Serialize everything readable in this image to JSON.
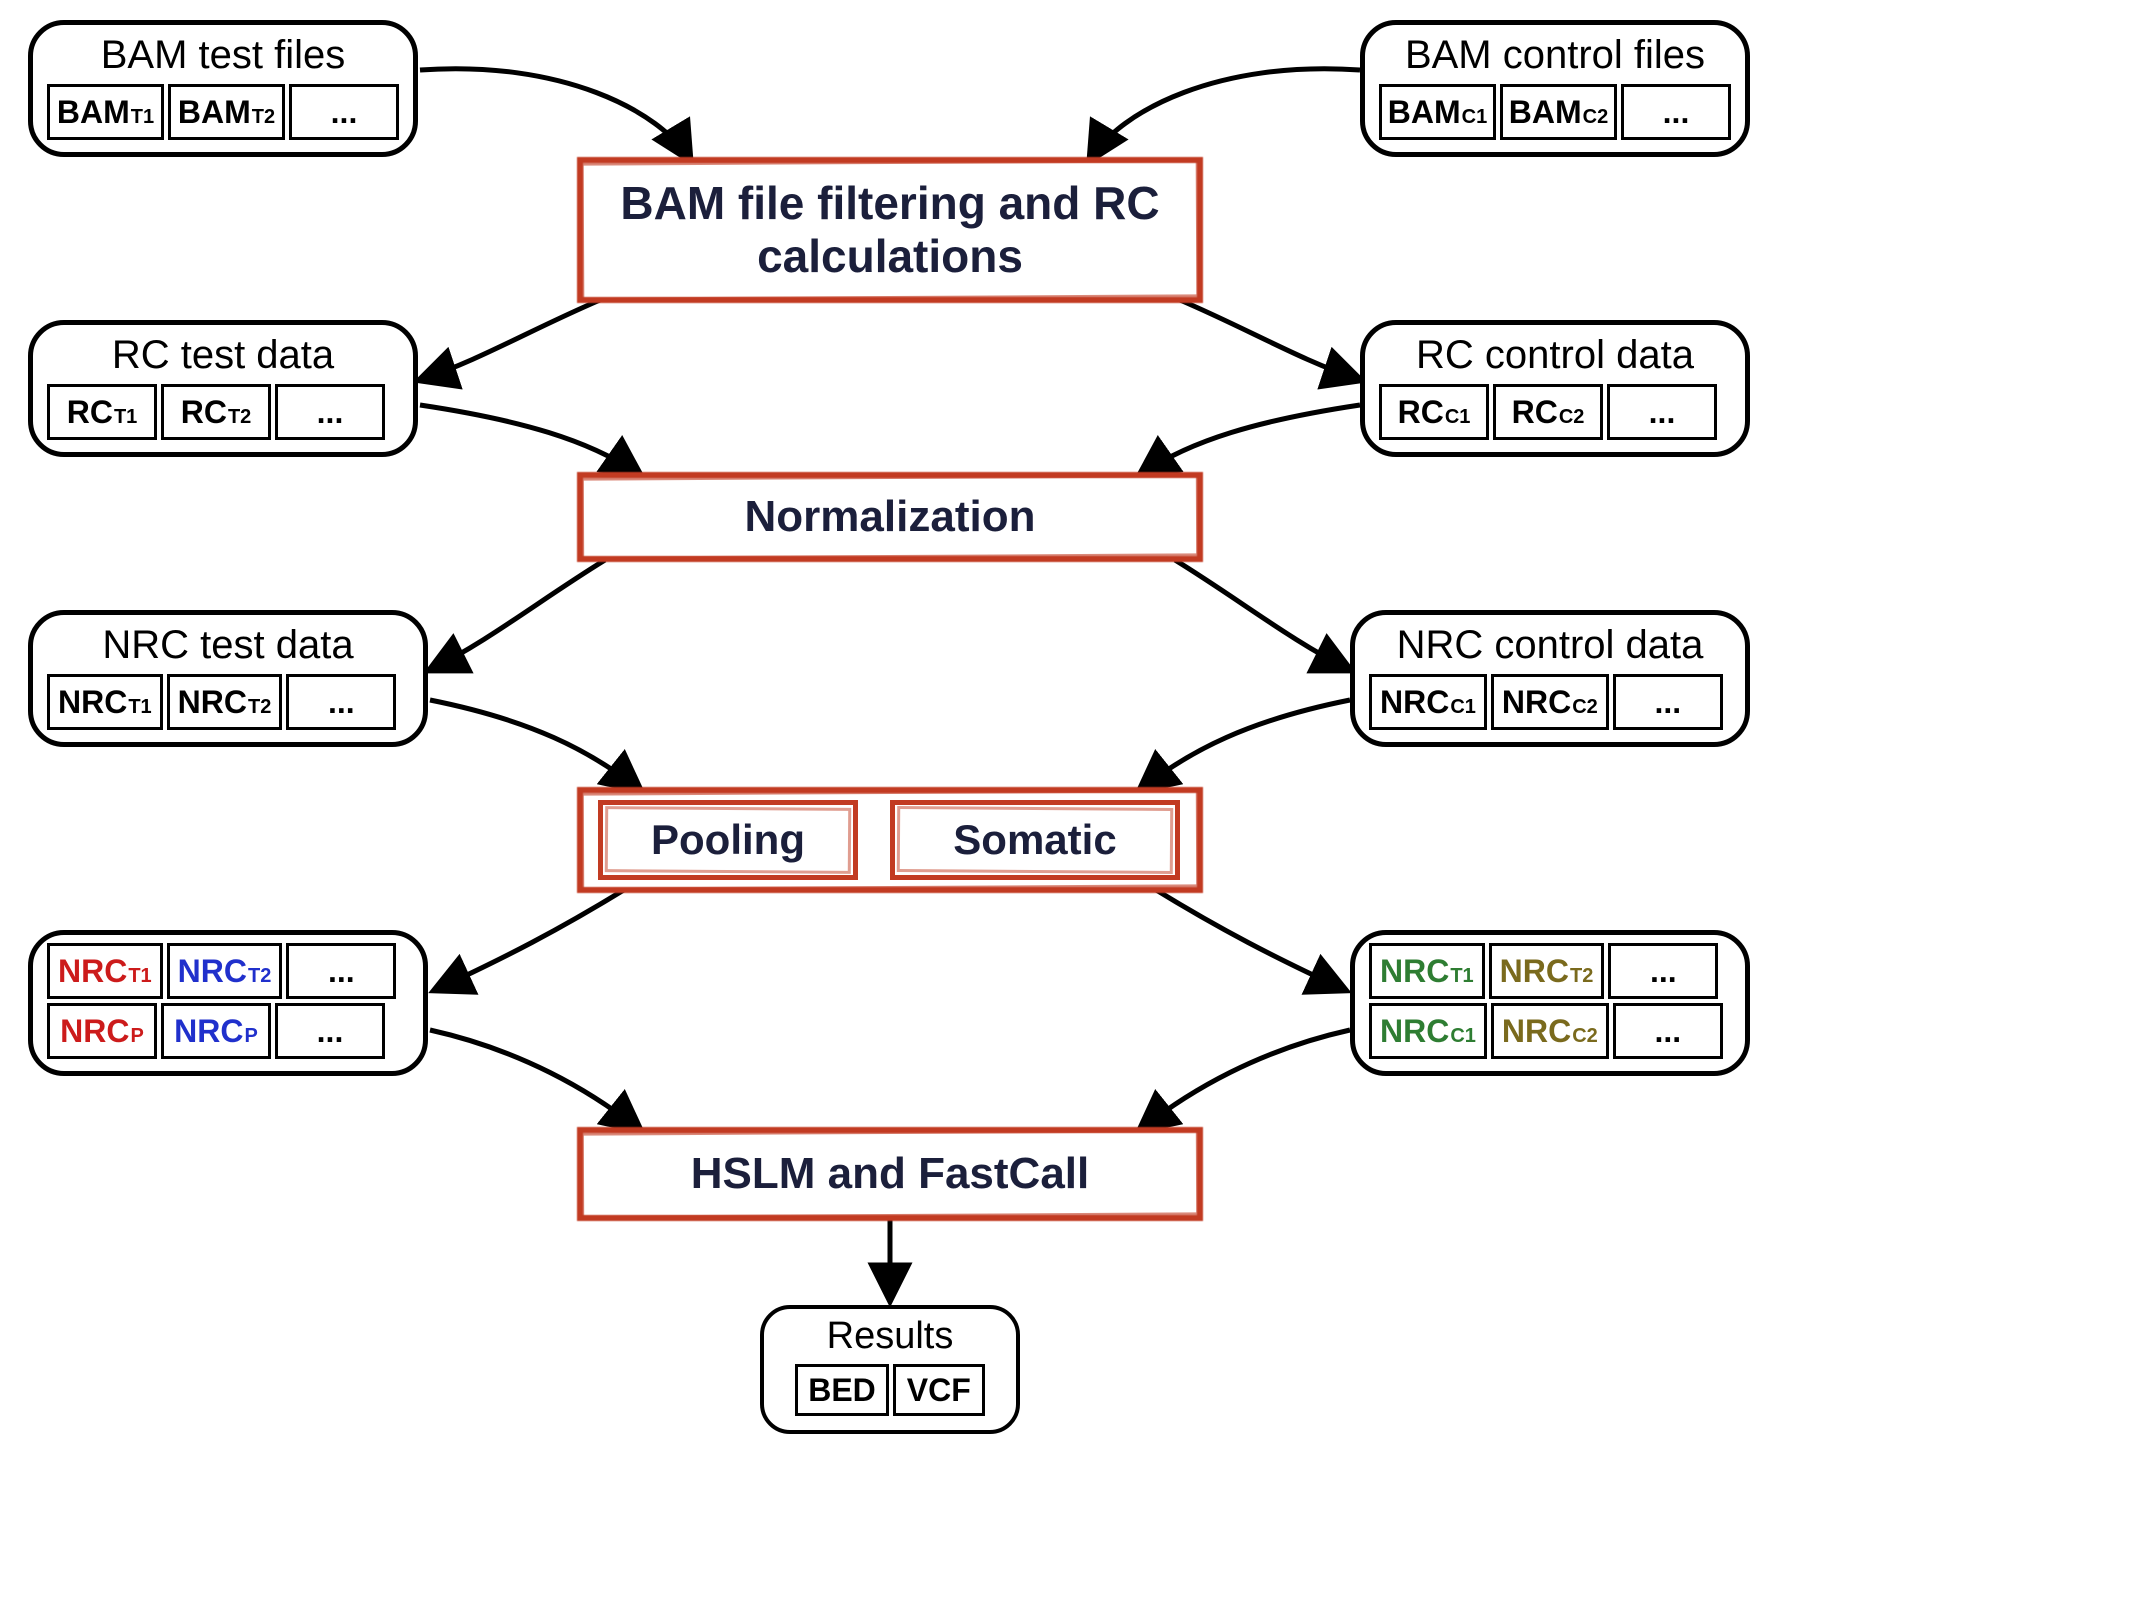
{
  "nodes": {
    "bam_test": {
      "title": "BAM test files",
      "cells": [
        {
          "prefix": "BAM",
          "sub": "T1"
        },
        {
          "prefix": "BAM",
          "sub": "T2"
        },
        {
          "dots": "..."
        }
      ]
    },
    "bam_control": {
      "title": "BAM control files",
      "cells": [
        {
          "prefix": "BAM",
          "sub": "C1"
        },
        {
          "prefix": "BAM",
          "sub": "C2"
        },
        {
          "dots": "..."
        }
      ]
    },
    "rc_test": {
      "title": "RC test data",
      "cells": [
        {
          "prefix": "RC",
          "sub": "T1"
        },
        {
          "prefix": "RC",
          "sub": "T2"
        },
        {
          "dots": "..."
        }
      ]
    },
    "rc_control": {
      "title": "RC control data",
      "cells": [
        {
          "prefix": "RC",
          "sub": "C1"
        },
        {
          "prefix": "RC",
          "sub": "C2"
        },
        {
          "dots": "..."
        }
      ]
    },
    "nrc_test": {
      "title": "NRC test data",
      "cells": [
        {
          "prefix": "NRC",
          "sub": "T1"
        },
        {
          "prefix": "NRC",
          "sub": "T2"
        },
        {
          "dots": "..."
        }
      ]
    },
    "nrc_control": {
      "title": "NRC control data",
      "cells": [
        {
          "prefix": "NRC",
          "sub": "C1"
        },
        {
          "prefix": "NRC",
          "sub": "C2"
        },
        {
          "dots": "..."
        }
      ]
    },
    "pool_left": {
      "rows": [
        [
          {
            "prefix": "NRC",
            "sub": "T1",
            "color": "red"
          },
          {
            "prefix": "NRC",
            "sub": "T2",
            "color": "blue"
          },
          {
            "dots": "..."
          }
        ],
        [
          {
            "prefix": "NRC",
            "sub": "P",
            "color": "red"
          },
          {
            "prefix": "NRC",
            "sub": "P",
            "color": "blue"
          },
          {
            "dots": "..."
          }
        ]
      ]
    },
    "pool_right": {
      "rows": [
        [
          {
            "prefix": "NRC",
            "sub": "T1",
            "color": "green"
          },
          {
            "prefix": "NRC",
            "sub": "T2",
            "color": "olive"
          },
          {
            "dots": "..."
          }
        ],
        [
          {
            "prefix": "NRC",
            "sub": "C1",
            "color": "green"
          },
          {
            "prefix": "NRC",
            "sub": "C2",
            "color": "olive"
          },
          {
            "dots": "..."
          }
        ]
      ]
    },
    "results": {
      "title": "Results",
      "cells": [
        "BED",
        "VCF"
      ]
    }
  },
  "processes": {
    "filtering": "BAM file filtering and RC calculations",
    "normalization": "Normalization",
    "pooling": "Pooling",
    "somatic": "Somatic",
    "hslm": "HSLM and FastCall"
  }
}
